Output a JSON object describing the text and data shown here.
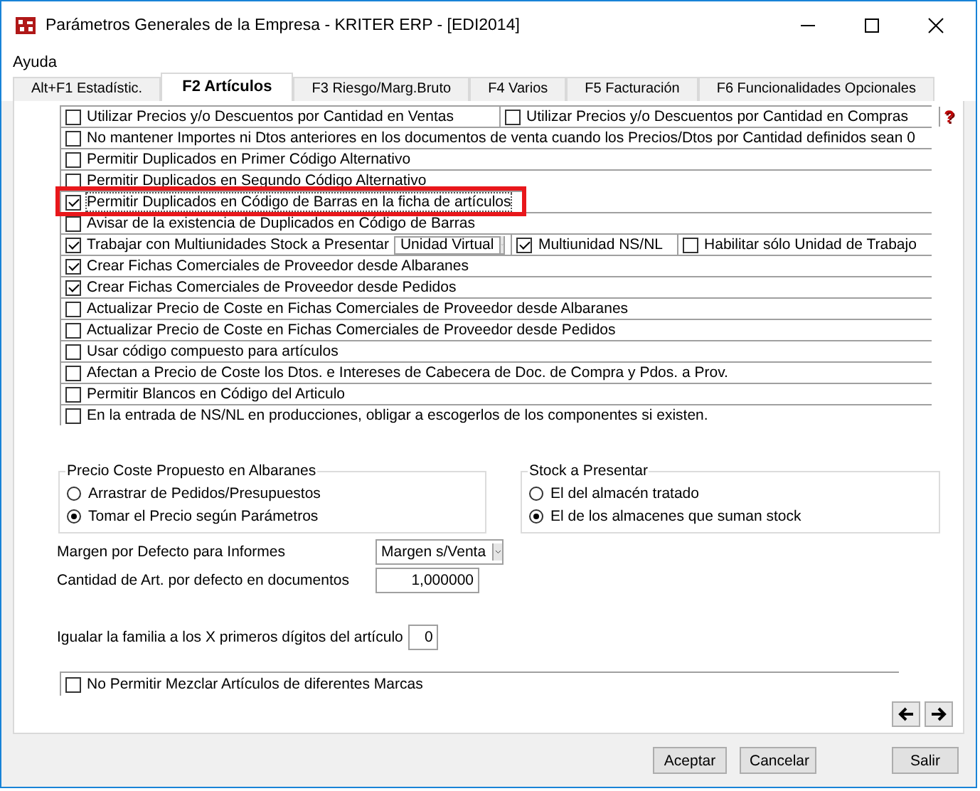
{
  "window": {
    "title": "Parámetros Generales de la Empresa - KRITER ERP - [EDI2014]"
  },
  "menu": [
    "Ayuda"
  ],
  "help": "?",
  "tabs": [
    {
      "label": "Alt+F1 Estadístic.",
      "selected": false
    },
    {
      "label": "F2 Artículos",
      "selected": true
    },
    {
      "label": "F3 Riesgo/Marg.Bruto",
      "selected": false
    },
    {
      "label": "F4 Varios",
      "selected": false
    },
    {
      "label": "F5 Facturación",
      "selected": false
    },
    {
      "label": "F6 Funcionalidades Opcionales",
      "selected": false
    }
  ],
  "options": [
    {
      "kind": "pair",
      "items": [
        {
          "label": "Utilizar Precios y/o Descuentos por Cantidad en Ventas",
          "checked": false
        },
        {
          "label": "Utilizar Precios y/o Descuentos por Cantidad en Compras",
          "checked": false
        }
      ]
    },
    {
      "kind": "check",
      "label": "No mantener Importes ni Dtos anteriores en los documentos de venta cuando los Precios/Dtos por Cantidad definidos sean 0",
      "checked": false,
      "highlighted": false
    },
    {
      "kind": "check",
      "label": "Permitir Duplicados en Primer Código Alternativo",
      "checked": false,
      "highlighted": false
    },
    {
      "kind": "check",
      "label": "Permitir Duplicados en Segundo Código Alternativo",
      "checked": false,
      "highlighted": false
    },
    {
      "kind": "check",
      "label": "Permitir Duplicados en Código de Barras en la ficha de artículos",
      "checked": true,
      "highlighted": true
    },
    {
      "kind": "check",
      "label": "Avisar de la existencia de Duplicados en Código de Barras",
      "checked": false,
      "highlighted": false
    },
    {
      "kind": "multi",
      "label": "Trabajar con Multiunidades",
      "checked": true,
      "stock_label": "Stock a Presentar",
      "stock_value": "Unidad Virtual",
      "extras": [
        {
          "label": "Multiunidad NS/NL",
          "checked": true
        },
        {
          "label": "Habilitar sólo Unidad de Trabajo",
          "checked": false
        }
      ]
    },
    {
      "kind": "check",
      "label": "Crear Fichas Comerciales de Proveedor desde Albaranes",
      "checked": true,
      "highlighted": false
    },
    {
      "kind": "check",
      "label": "Crear Fichas Comerciales de Proveedor desde Pedidos",
      "checked": true,
      "highlighted": false
    },
    {
      "kind": "check",
      "label": "Actualizar Precio de Coste en Fichas Comerciales de Proveedor desde Albaranes",
      "checked": false,
      "highlighted": false
    },
    {
      "kind": "check",
      "label": "Actualizar Precio de Coste en Fichas Comerciales de Proveedor desde Pedidos",
      "checked": false,
      "highlighted": false
    },
    {
      "kind": "check",
      "label": "Usar código compuesto para artículos",
      "checked": false,
      "highlighted": false
    },
    {
      "kind": "check",
      "label": "Afectan a Precio de Coste los Dtos. e Intereses de Cabecera de Doc. de Compra y Pdos. a Prov.",
      "checked": false,
      "highlighted": false
    },
    {
      "kind": "check",
      "label": "Permitir Blancos en Código del Articulo",
      "checked": false,
      "highlighted": false
    },
    {
      "kind": "check",
      "label": "En la entrada de NS/NL en producciones, obligar a escogerlos de los componentes si existen.",
      "checked": false,
      "highlighted": false
    }
  ],
  "groups": [
    {
      "title": "Precio Coste Propuesto en Albaranes",
      "options": [
        {
          "label": "Arrastrar de Pedidos/Presupuestos",
          "selected": false
        },
        {
          "label": "Tomar el Precio según Parámetros",
          "selected": true
        }
      ]
    },
    {
      "title": "Stock a Presentar",
      "options": [
        {
          "label": "El del almacén tratado",
          "selected": false
        },
        {
          "label": "El de los almacenes que suman stock",
          "selected": true
        }
      ]
    }
  ],
  "fields": [
    {
      "kind": "select",
      "label": "Margen por Defecto para Informes",
      "value": "Margen s/Venta"
    },
    {
      "kind": "number",
      "label": "Cantidad de Art. por defecto en documentos",
      "value": "1,000000"
    },
    {
      "kind": "small",
      "label": "Igualar la familia a los X primeros dígitos del artículo",
      "value": "0"
    }
  ],
  "bottom_option": {
    "label": "No Permitir Mezclar Artículos de diferentes Marcas",
    "checked": false
  },
  "buttons": [
    "Aceptar",
    "Cancelar",
    "Salir"
  ]
}
